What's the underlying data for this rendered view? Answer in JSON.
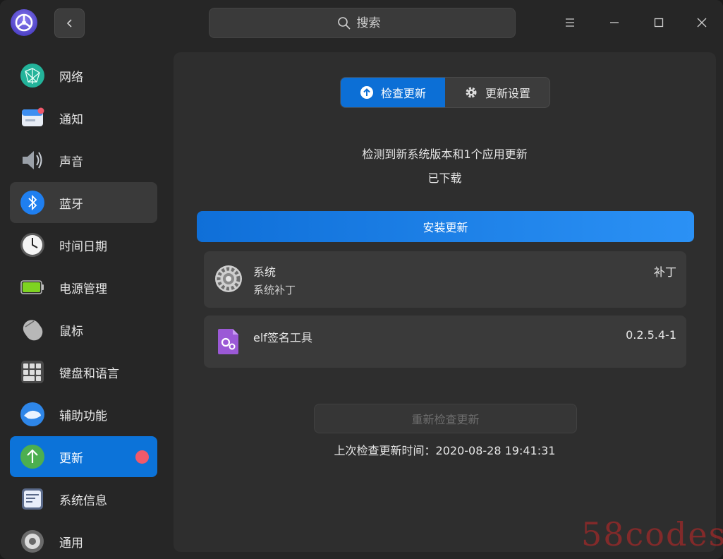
{
  "header": {
    "search_placeholder": "搜索"
  },
  "sidebar": {
    "items": [
      {
        "label": "网络",
        "icon": "network-icon"
      },
      {
        "label": "通知",
        "icon": "notification-icon"
      },
      {
        "label": "声音",
        "icon": "sound-icon"
      },
      {
        "label": "蓝牙",
        "icon": "bluetooth-icon",
        "state": "hover"
      },
      {
        "label": "时间日期",
        "icon": "clock-icon"
      },
      {
        "label": "电源管理",
        "icon": "battery-icon"
      },
      {
        "label": "鼠标",
        "icon": "mouse-icon"
      },
      {
        "label": "键盘和语言",
        "icon": "keyboard-icon"
      },
      {
        "label": "辅助功能",
        "icon": "accessibility-icon"
      },
      {
        "label": "更新",
        "icon": "update-icon",
        "state": "active",
        "badge": true
      },
      {
        "label": "系统信息",
        "icon": "system-info-icon"
      },
      {
        "label": "通用",
        "icon": "general-icon"
      }
    ]
  },
  "main": {
    "tabs": [
      {
        "label": "检查更新",
        "selected": true
      },
      {
        "label": "更新设置",
        "selected": false
      }
    ],
    "status_line1": "检测到新系统版本和1个应用更新",
    "status_line2": "已下载",
    "install_label": "安装更新",
    "updates": [
      {
        "title": "系统",
        "subtitle": "系统补丁",
        "right": "补丁",
        "icon": "system-gear-icon"
      },
      {
        "title": "elf签名工具",
        "subtitle": "",
        "right": "0.2.5.4-1",
        "icon": "elf-sign-tool-icon"
      }
    ],
    "recheck_label": "重新检查更新",
    "last_check": "上次检查更新时间：2020-08-28 19:41:31"
  },
  "watermark": "58codes",
  "colors": {
    "accent": "#0c73d9",
    "badge": "#f0596b",
    "install_gradient_start": "#0f6fd8",
    "install_gradient_end": "#2b91f5"
  }
}
